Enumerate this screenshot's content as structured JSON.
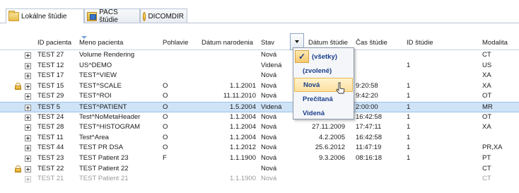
{
  "tabs": [
    {
      "label": "Lokálne štúdie",
      "icon": "folder-icon",
      "active": true
    },
    {
      "label": "PACS štúdie",
      "icon": "pacs-icon",
      "active": false
    },
    {
      "label": "DICOMDIR",
      "icon": "dicomdir-icon",
      "active": false
    }
  ],
  "columns": {
    "id": "ID pacienta",
    "name": "Meno pacienta",
    "sex": "Pohlavie",
    "dob": "Dátum narodenia",
    "state": "Stav",
    "study_date": "Dátum štúdie",
    "study_time": "Čas štúdie",
    "study_id": "ID štúdie",
    "modality": "Modalita"
  },
  "rows": [
    {
      "id": "TEST 27",
      "name": "Volume Rendering",
      "sex": "",
      "dob": "",
      "state": "Nová",
      "study_date": "",
      "study_time": "",
      "study_id": "",
      "modality": "CT",
      "locked": false
    },
    {
      "id": "TEST 12",
      "name": "US^DEMO",
      "sex": "",
      "dob": "",
      "state": "Videná",
      "study_date": "",
      "study_time": "",
      "study_id": "1",
      "modality": "US",
      "locked": false
    },
    {
      "id": "TEST 17",
      "name": "TEST^VIEW",
      "sex": "",
      "dob": "",
      "state": "Nová",
      "study_date": "",
      "study_time": "",
      "study_id": "",
      "modality": "XA",
      "locked": false
    },
    {
      "id": "TEST 15",
      "name": "TEST^SCALE",
      "sex": "O",
      "dob": "1.1.2001",
      "state": "Nová",
      "study_date": "",
      "study_time": "9:20:58",
      "study_id": "1",
      "modality": "XA",
      "locked": true
    },
    {
      "id": "TEST 29",
      "name": "TEST^ROI",
      "sex": "O",
      "dob": "11.11.2010",
      "state": "Nová",
      "study_date": "",
      "study_time": "9:42:20",
      "study_id": "1",
      "modality": "OT",
      "locked": false
    },
    {
      "id": "TEST 5",
      "name": "TEST^PATIENT",
      "sex": "O",
      "dob": "1.5.2004",
      "state": "Videná",
      "study_date": "",
      "study_time": "2:00:00",
      "study_id": "1",
      "modality": "MR",
      "locked": false,
      "selected": true
    },
    {
      "id": "TEST 24",
      "name": "Test^NoMetaHeader",
      "sex": "O",
      "dob": "1.1.2004",
      "state": "Nová",
      "study_date": "4.8.2006",
      "study_time": "16:42:58",
      "study_id": "1",
      "modality": "OT",
      "locked": false
    },
    {
      "id": "TEST 28",
      "name": "TEST^HISTOGRAM",
      "sex": "O",
      "dob": "1.1.2004",
      "state": "Nová",
      "study_date": "27.11.2009",
      "study_time": "17:47:11",
      "study_id": "1",
      "modality": "XA",
      "locked": false
    },
    {
      "id": "TEST 11",
      "name": "Test^Area",
      "sex": "O",
      "dob": "1.1.2004",
      "state": "Nová",
      "study_date": "4.2.2005",
      "study_time": "16:42:58",
      "study_id": "1",
      "modality": "",
      "locked": false
    },
    {
      "id": "TEST 44",
      "name": "TEST PR DSA",
      "sex": "O",
      "dob": "1.1.2012",
      "state": "Nová",
      "study_date": "25.6.2012",
      "study_time": "11:47:19",
      "study_id": "1",
      "modality": "PR,XA",
      "locked": false
    },
    {
      "id": "TEST 23",
      "name": "TEST Patient 23",
      "sex": "F",
      "dob": "1.1.1900",
      "state": "Nová",
      "study_date": "9.3.2006",
      "study_time": "08:16:18",
      "study_id": "1",
      "modality": "PT",
      "locked": false
    },
    {
      "id": "TEST 22",
      "name": "TEST Patient 22",
      "sex": "",
      "dob": "",
      "state": "Nová",
      "study_date": "",
      "study_time": "",
      "study_id": "",
      "modality": "CT",
      "locked": true
    },
    {
      "id": "TEST 21",
      "name": "TEST Patient 21",
      "sex": "",
      "dob": "1.1.1900",
      "state": "Nová",
      "study_date": "",
      "study_time": "",
      "study_id": "",
      "modality": "CT",
      "locked": false,
      "partial": true
    }
  ],
  "filter_menu": {
    "items": [
      {
        "label": "(všetky)",
        "checked": true,
        "hover": false
      },
      {
        "label": "(zvolené)",
        "checked": false,
        "hover": false
      },
      {
        "label": "Nová",
        "checked": false,
        "hover": true
      },
      {
        "label": "Prečítaná",
        "checked": false,
        "hover": false
      },
      {
        "label": "Videná",
        "checked": false,
        "hover": false
      }
    ],
    "check_glyph": "✓"
  },
  "colors": {
    "selected_row": "#cfe3f7",
    "menu_text": "#1a3e8a",
    "hover_item": "#fde0a0"
  }
}
